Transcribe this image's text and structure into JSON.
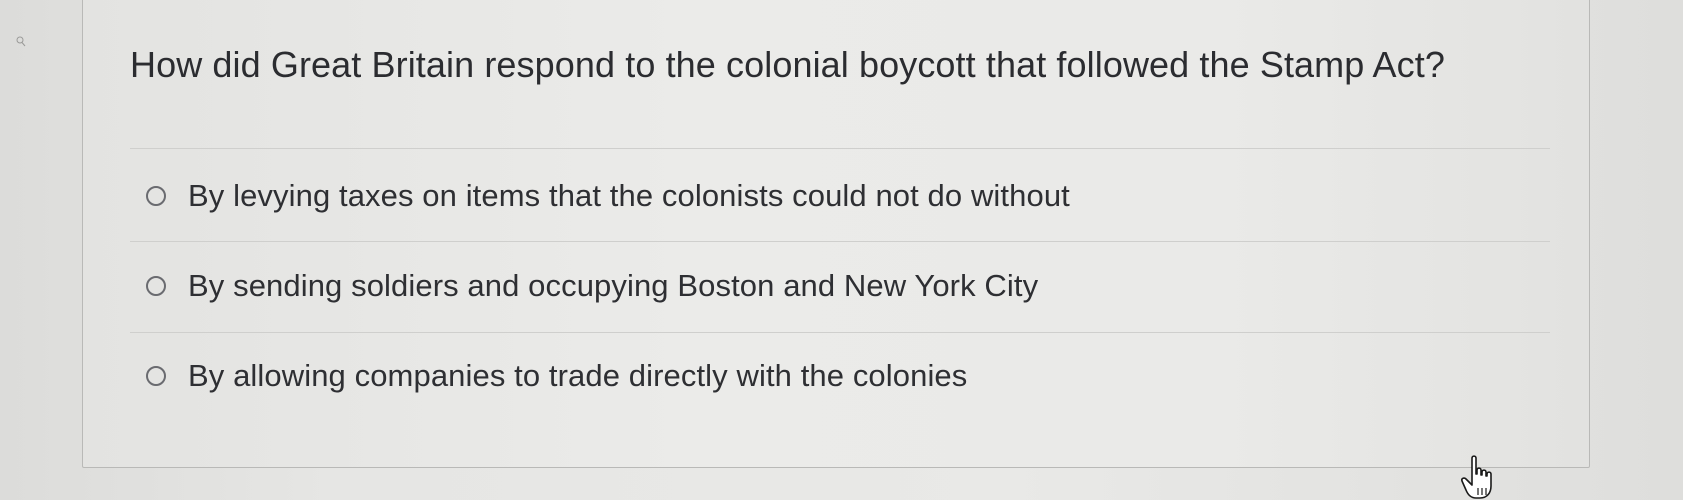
{
  "question": {
    "text": "How did Great Britain respond to the colonial boycott that followed the Stamp Act?"
  },
  "options": [
    {
      "label": "By levying taxes on items that the colonists could not do without",
      "selected": false
    },
    {
      "label": "By sending soldiers and occupying Boston and New York City",
      "selected": false
    },
    {
      "label": "By allowing companies to trade directly with the colonies",
      "selected": false
    }
  ],
  "icons": {
    "cursor": "hand-pointer-icon",
    "corner": "magnifier-icon"
  },
  "colors": {
    "background": "#e8e8e6",
    "text": "#2e2f33",
    "radio_border": "#6a6b70",
    "divider": "#cfcfcd"
  }
}
